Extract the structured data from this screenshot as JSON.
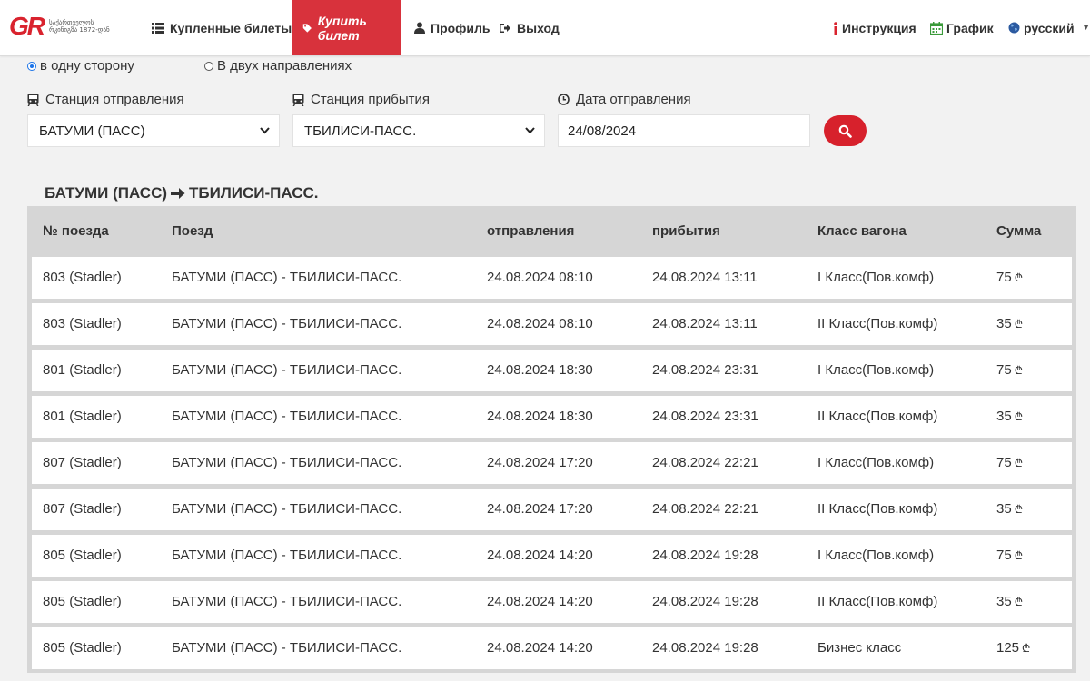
{
  "brand": {
    "logo_letters": "GR",
    "logo_text": "საქართველოს რკინიგზა 1872-დან"
  },
  "nav": {
    "purchased": "Купленные билеты",
    "buy": "Купить билет",
    "profile": "Профиль",
    "logout": "Выход",
    "instructions": "Инструкция",
    "schedule": "График",
    "language": "русский"
  },
  "trip_type": {
    "one_way": "в одну сторону",
    "round_trip": "В двух направлениях",
    "selected": "one_way"
  },
  "form": {
    "departure_label": "Станция отправления",
    "departure_value": "БАТУМИ (ПАСС)",
    "arrival_label": "Станция прибытия",
    "arrival_value": "ТБИЛИСИ-ПАСС.",
    "date_label": "Дата отправления",
    "date_value": "24/08/2024"
  },
  "route": {
    "from": "БАТУМИ (ПАСС)",
    "to": "ТБИЛИСИ-ПАСС."
  },
  "table": {
    "headers": [
      "№ поезда",
      "Поезд",
      "отправления",
      "прибытия",
      "Класс вагона",
      "Сумма"
    ],
    "currency_symbol": "₾",
    "rows": [
      {
        "number": "803 (Stadler)",
        "train": "БАТУМИ (ПАСС) - ТБИЛИСИ-ПАСС.",
        "departure": "24.08.2024 08:10",
        "arrival": "24.08.2024 13:11",
        "class": "I Класс(Пов.комф)",
        "price": "75"
      },
      {
        "number": "803 (Stadler)",
        "train": "БАТУМИ (ПАСС) - ТБИЛИСИ-ПАСС.",
        "departure": "24.08.2024 08:10",
        "arrival": "24.08.2024 13:11",
        "class": "II Класс(Пов.комф)",
        "price": "35"
      },
      {
        "number": "801 (Stadler)",
        "train": "БАТУМИ (ПАСС) - ТБИЛИСИ-ПАСС.",
        "departure": "24.08.2024 18:30",
        "arrival": "24.08.2024 23:31",
        "class": "I Класс(Пов.комф)",
        "price": "75"
      },
      {
        "number": "801 (Stadler)",
        "train": "БАТУМИ (ПАСС) - ТБИЛИСИ-ПАСС.",
        "departure": "24.08.2024 18:30",
        "arrival": "24.08.2024 23:31",
        "class": "II Класс(Пов.комф)",
        "price": "35"
      },
      {
        "number": "807 (Stadler)",
        "train": "БАТУМИ (ПАСС) - ТБИЛИСИ-ПАСС.",
        "departure": "24.08.2024 17:20",
        "arrival": "24.08.2024 22:21",
        "class": "I Класс(Пов.комф)",
        "price": "75"
      },
      {
        "number": "807 (Stadler)",
        "train": "БАТУМИ (ПАСС) - ТБИЛИСИ-ПАСС.",
        "departure": "24.08.2024 17:20",
        "arrival": "24.08.2024 22:21",
        "class": "II Класс(Пов.комф)",
        "price": "35"
      },
      {
        "number": "805 (Stadler)",
        "train": "БАТУМИ (ПАСС) - ТБИЛИСИ-ПАСС.",
        "departure": "24.08.2024 14:20",
        "arrival": "24.08.2024 19:28",
        "class": "I Класс(Пов.комф)",
        "price": "75"
      },
      {
        "number": "805 (Stadler)",
        "train": "БАТУМИ (ПАСС) - ТБИЛИСИ-ПАСС.",
        "departure": "24.08.2024 14:20",
        "arrival": "24.08.2024 19:28",
        "class": "II Класс(Пов.комф)",
        "price": "35"
      },
      {
        "number": "805 (Stadler)",
        "train": "БАТУМИ (ПАСС) - ТБИЛИСИ-ПАСС.",
        "departure": "24.08.2024 14:20",
        "arrival": "24.08.2024 19:28",
        "class": "Бизнес класс",
        "price": "125"
      }
    ]
  },
  "colors": {
    "accent": "#d8323c",
    "radio_selected": "#1a73e8",
    "schedule_icon": "#3a9a3a",
    "instruction_icon": "#d9232e",
    "globe_icon": "#2c5aa0"
  },
  "icons": {
    "purchased": "list-icon",
    "buy": "ticket-tag-icon",
    "profile": "user-icon",
    "logout": "sign-out-icon",
    "instructions": "info-icon",
    "schedule": "calendar-icon",
    "language": "globe-icon",
    "station": "train-icon",
    "date": "clock-icon",
    "search": "search-icon",
    "route_arrow": "arrow-right-icon"
  }
}
